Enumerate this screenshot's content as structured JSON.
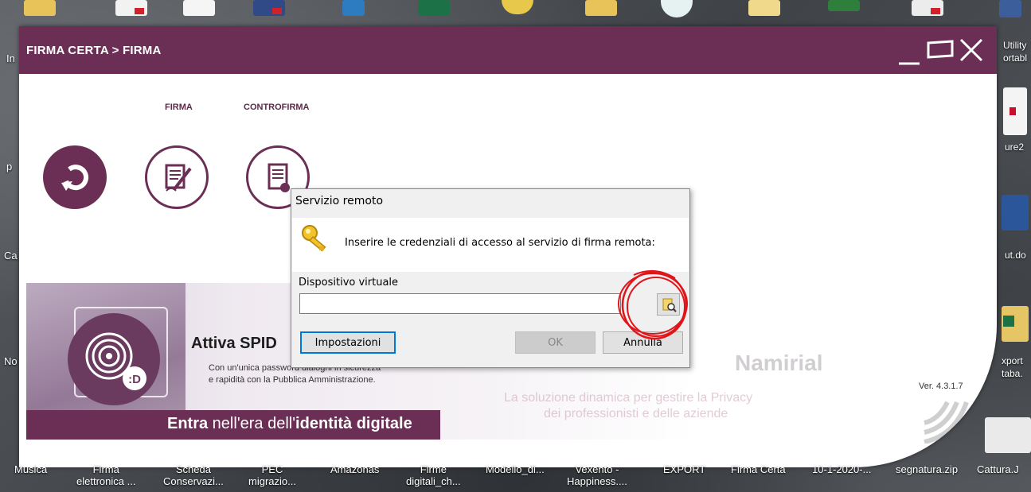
{
  "window": {
    "title": "FIRMA CERTA > FIRMA",
    "minimize_symbol": "__",
    "maximize_symbol": "▭",
    "close_symbol": "✕"
  },
  "tabs": [
    {
      "label": "FIRMA"
    },
    {
      "label": "CONTROFIRMA"
    }
  ],
  "banner": {
    "title": "Attiva SPID",
    "subtitle_line1": "Con un'unica password dialoghi in sicurezza",
    "subtitle_line2": "e rapidità con la Pubblica Amministrazione.",
    "strip_prefix": "Entra",
    "strip_mid": " nell'era dell'",
    "strip_bold": "identità digitale",
    "badge": ":D",
    "namirial_line1": "La soluzione dinamica per gestire la Privacy",
    "namirial_line2": "dei professionisti e delle aziende",
    "namirial_logo": "Namirial"
  },
  "version": "Ver. 4.3.1.7",
  "dialog": {
    "title": "Servizio remoto",
    "message": "Inserire le credenziali di accesso al servizio di firma remota:",
    "field_label": "Dispositivo virtuale",
    "field_value": "",
    "settings_button": "Impostazioni",
    "ok_button": "OK",
    "cancel_button": "Annulla"
  },
  "desktop": {
    "left_labels": [
      "In",
      "p",
      "Ca",
      "No"
    ],
    "right_labels": [
      "Utility",
      "ortabl",
      "ure2",
      "ut.do",
      "xport",
      "taba."
    ],
    "taskbar_items": [
      {
        "line1": "Musica",
        "line2": ""
      },
      {
        "line1": "Firma",
        "line2": "elettronica ..."
      },
      {
        "line1": "Scheda",
        "line2": "Conservazi..."
      },
      {
        "line1": "PEC",
        "line2": "migrazio..."
      },
      {
        "line1": "Amazonas",
        "line2": ""
      },
      {
        "line1": "Firme",
        "line2": "digitali_ch..."
      },
      {
        "line1": "Modello_di...",
        "line2": ""
      },
      {
        "line1": "Vexento -",
        "line2": "Happiness...."
      },
      {
        "line1": "EXPORT",
        "line2": ""
      },
      {
        "line1": "Firma Certa",
        "line2": ""
      },
      {
        "line1": "10-1-2020-...",
        "line2": ""
      },
      {
        "line1": "segnatura.zip",
        "line2": ""
      },
      {
        "line1": "Cattura.J",
        "line2": ""
      }
    ]
  },
  "colors": {
    "brand": "#6b2f55",
    "annotation": "#e0151a"
  }
}
